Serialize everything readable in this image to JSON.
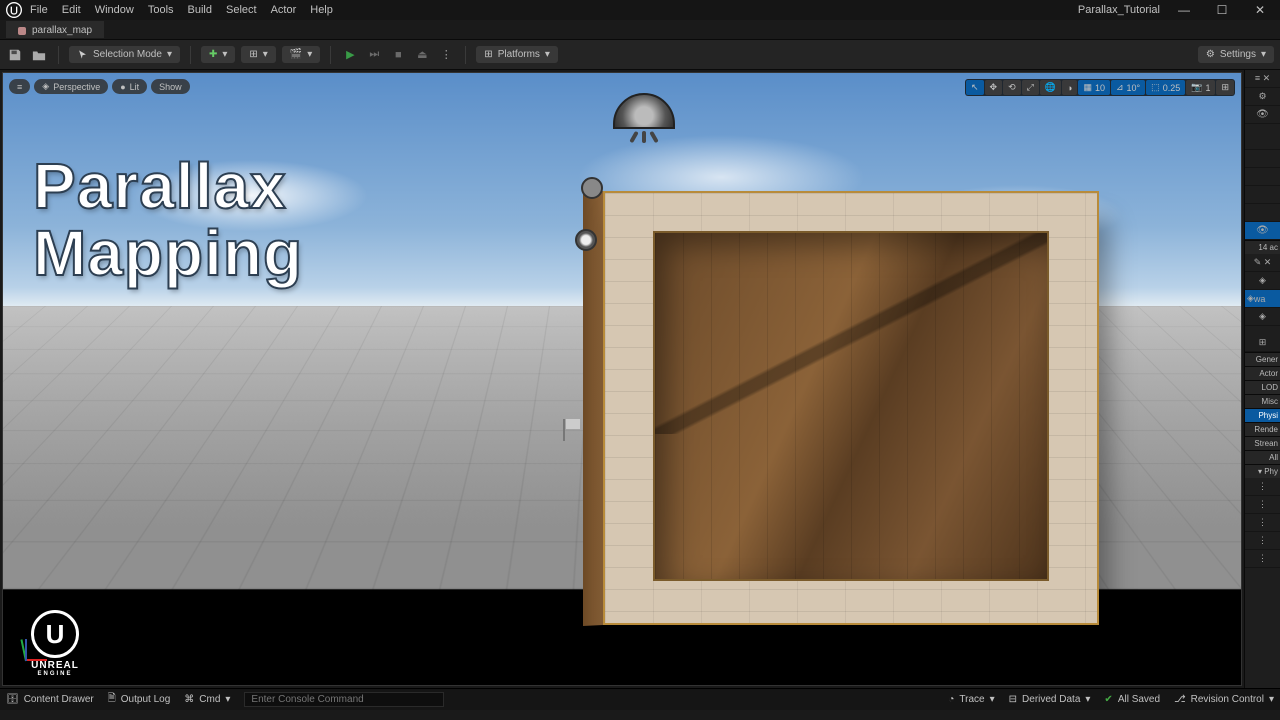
{
  "title": "Parallax_Tutorial",
  "tab": {
    "label": "parallax_map"
  },
  "menu": [
    "File",
    "Edit",
    "Window",
    "Tools",
    "Build",
    "Select",
    "Actor",
    "Help"
  ],
  "toolbar": {
    "mode": "Selection Mode",
    "platforms": "Platforms",
    "settings": "Settings"
  },
  "viewport": {
    "pills": {
      "menu": "≡",
      "perspective": "Perspective",
      "lit": "Lit",
      "show": "Show"
    },
    "snap_grid": "10",
    "snap_angle": "10°",
    "snap_scale": "0.25",
    "cam_speed": "1"
  },
  "overlay": {
    "line1": "Parallax",
    "line2": "Mapping"
  },
  "watermark": {
    "brand": "UNREAL",
    "sub": "ENGINE",
    "letter": "U"
  },
  "outliner": {
    "count_label": "14 ac",
    "wall_label": "wa"
  },
  "details": {
    "sections": [
      "Gener",
      "Actor",
      "LOD",
      "Misc",
      "Physi",
      "Rende",
      "Strean",
      "All"
    ],
    "active_index": 4,
    "group": "Phy"
  },
  "status": {
    "content_drawer": "Content Drawer",
    "output_log": "Output Log",
    "cmd": "Cmd",
    "cmd_placeholder": "Enter Console Command",
    "trace": "Trace",
    "derived": "Derived Data",
    "saved": "All Saved",
    "revision": "Revision Control"
  }
}
